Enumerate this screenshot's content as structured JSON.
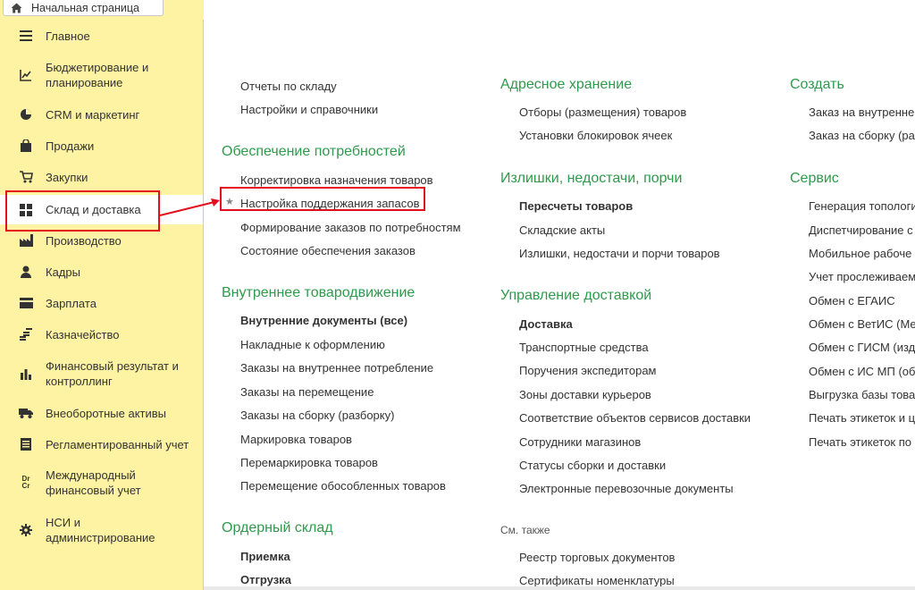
{
  "home_tab": {
    "label": "Начальная страница",
    "icon": "home-icon"
  },
  "sidebar": {
    "items": [
      {
        "label": "Главное",
        "icon": "hamburger-icon"
      },
      {
        "label": "Бюджетирование и планирование",
        "icon": "chart-icon"
      },
      {
        "label": "CRM и маркетинг",
        "icon": "pie-icon"
      },
      {
        "label": "Продажи",
        "icon": "bag-icon"
      },
      {
        "label": "Закупки",
        "icon": "cart-icon"
      },
      {
        "label": "Склад и доставка",
        "icon": "grid-icon",
        "active": true
      },
      {
        "label": "Производство",
        "icon": "factory-icon"
      },
      {
        "label": "Кадры",
        "icon": "person-icon"
      },
      {
        "label": "Зарплата",
        "icon": "wallet-icon"
      },
      {
        "label": "Казначейство",
        "icon": "coins-icon"
      },
      {
        "label": "Финансовый результат и контроллинг",
        "icon": "bars-icon"
      },
      {
        "label": "Внеоборотные активы",
        "icon": "truck-icon"
      },
      {
        "label": "Регламентированный учет",
        "icon": "ledger-icon"
      },
      {
        "label": "Международный финансовый учет",
        "icon": "drcr-icon",
        "icon_text": "Dr Cr"
      },
      {
        "label": "НСИ и администрирование",
        "icon": "gear-icon"
      }
    ]
  },
  "col1": {
    "top_links": [
      "Отчеты по складу",
      "Настройки и справочники"
    ],
    "sections": [
      {
        "title": "Обеспечение потребностей",
        "links": [
          "Корректировка назначения товаров",
          "Настройка поддержания запасов",
          "Формирование заказов по потребностям",
          "Состояние обеспечения заказов"
        ]
      },
      {
        "title": "Внутреннее товародвижение",
        "links": [
          "Внутренние документы (все)",
          "Накладные к оформлению",
          "Заказы на внутреннее потребление",
          "Заказы на перемещение",
          "Заказы на сборку (разборку)",
          "Маркировка товаров",
          "Перемаркировка товаров",
          "Перемещение обособленных товаров"
        ]
      },
      {
        "title": "Ордерный склад",
        "links": [
          "Приемка",
          "Отгрузка"
        ]
      }
    ]
  },
  "col2": {
    "sections": [
      {
        "title": "Адресное хранение",
        "links": [
          "Отборы (размещения) товаров",
          "Установки блокировок ячеек"
        ]
      },
      {
        "title": "Излишки, недостачи, порчи",
        "links": [
          "Пересчеты товаров",
          "Складские акты",
          "Излишки, недостачи и порчи товаров"
        ]
      },
      {
        "title": "Управление доставкой",
        "links": [
          "Доставка",
          "Транспортные средства",
          "Поручения экспедиторам",
          "Зоны доставки курьеров",
          "Соответствие объектов сервисов доставки",
          "Сотрудники магазинов",
          "Статусы сборки и доставки",
          "Электронные перевозочные документы"
        ]
      }
    ],
    "see_also": {
      "title": "См. также",
      "links": [
        "Реестр торговых документов",
        "Сертификаты номенклатуры"
      ]
    }
  },
  "col3": {
    "sections": [
      {
        "title": "Создать",
        "links": [
          "Заказ на внутренне",
          "Заказ на сборку (ра"
        ]
      },
      {
        "title": "Сервис",
        "links": [
          "Генерация топологи",
          "Диспетчирование с",
          "Мобильное рабоче",
          "Учет прослеживаем",
          "Обмен с ЕГАИС",
          "Обмен с ВетИС (Ме",
          "Обмен с ГИСМ (изд",
          "Обмен с ИС МП (об",
          "Выгрузка базы това",
          "Печать этикеток и ц",
          "Печать этикеток по"
        ]
      }
    ]
  },
  "colors": {
    "accent_green": "#2e9a4c",
    "sidebar_bg": "#fdf3a3",
    "highlight_red": "#e2101c"
  }
}
